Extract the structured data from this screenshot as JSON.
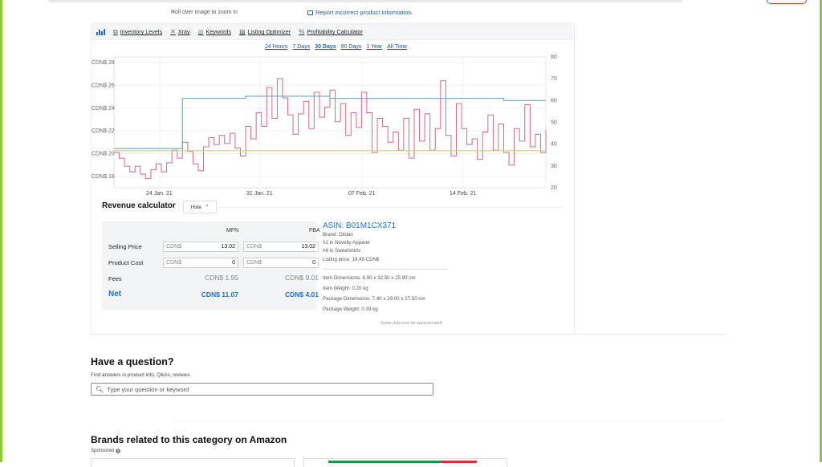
{
  "header": {
    "rollover_text": "Roll over image to zoom in",
    "report_text": "Report incorrect product information."
  },
  "keepa": {
    "toolbar": [
      {
        "icon": "box-icon",
        "label": "Inventory Levels"
      },
      {
        "icon": "close-icon",
        "label": "Xray"
      },
      {
        "icon": "target-icon",
        "label": "Keywords"
      },
      {
        "icon": "document-icon",
        "label": "Listing Optimizer"
      },
      {
        "icon": "percent-icon",
        "label": "Profitability Calculator"
      }
    ],
    "ranges": [
      "24 Hours",
      "7 Days",
      "30 Days",
      "90 Days",
      "1 Year",
      "All Time"
    ],
    "active_range": "30 Days"
  },
  "chart_data": {
    "type": "line",
    "x_ticks": [
      "24 Jan. 21",
      "31 Jan. 21",
      "07 Feb. 21",
      "14 Feb. 21"
    ],
    "y_left_ticks": [
      "CDN$ 18",
      "CDN$ 20",
      "CDN$ 22",
      "CDN$ 24",
      "CDN$ 26",
      "CDN$ 28"
    ],
    "y_right_ticks": [
      "20",
      "30",
      "40",
      "50",
      "60",
      "70",
      "80"
    ],
    "ylim_left": [
      17,
      28.5
    ],
    "ylim_right": [
      20,
      80
    ],
    "grid": true,
    "series": [
      {
        "color": "#d16b82",
        "axis": "left",
        "values": [
          20.1,
          19.6,
          18.9,
          18.4,
          18.9,
          18.2,
          17.8,
          18.6,
          19.1,
          18.4,
          19.2,
          20.3,
          19.6,
          21.0,
          20.2,
          19.1,
          18.5,
          20.6,
          21.4,
          20.8,
          21.6,
          20.9,
          21.8,
          20.5,
          19.8,
          22.4,
          21.3,
          23.6,
          22.4,
          25.8,
          23.1,
          26.6,
          24.9,
          23.4,
          21.7,
          23.5,
          24.6,
          22.2,
          25.4,
          23.2,
          24.1,
          25.6,
          22.8,
          24.4,
          21.6,
          23.6,
          22.3,
          25.4,
          23.6,
          20.1,
          23.1,
          22.4,
          21.0,
          21.9,
          20.3,
          23.1,
          19.6,
          23.9,
          21.1,
          23.5,
          20.3,
          22.2,
          26.4,
          21.6,
          19.8,
          24.4,
          22.2,
          20.8,
          21.3,
          19.5,
          21.9,
          23.4,
          20.3,
          22.6,
          20.1,
          19.0,
          22.2,
          21.1,
          24.3,
          20.6,
          21.7,
          20.1,
          22.1
        ]
      },
      {
        "color": "#6a9fd8",
        "axis": "right",
        "values": [
          38,
          38,
          38,
          38,
          38,
          38,
          38,
          38,
          38,
          38,
          38,
          38,
          38,
          61,
          61,
          61,
          61,
          61,
          61,
          61,
          61,
          61,
          61,
          61,
          61,
          62,
          62,
          62,
          62,
          62,
          62,
          62,
          62,
          62,
          62,
          62,
          62,
          62,
          62,
          62,
          62,
          61,
          61,
          61,
          61,
          61,
          61,
          61,
          61,
          61,
          61,
          61,
          61,
          61,
          61,
          61,
          61,
          61,
          61,
          61,
          61,
          61,
          61,
          61,
          61,
          61,
          61,
          61,
          61,
          61,
          61,
          61,
          61,
          61,
          60,
          60,
          60,
          60,
          60,
          60,
          60,
          60,
          60
        ]
      },
      {
        "color": "#d9d26a",
        "axis": "right",
        "values": [
          37,
          37,
          37,
          37,
          37,
          37,
          37,
          37,
          37,
          37,
          37,
          37,
          37,
          37,
          37,
          37,
          37,
          37,
          37,
          37,
          37,
          37,
          37,
          37,
          37,
          37,
          37,
          37,
          37,
          37,
          37,
          37,
          37,
          37,
          37,
          37,
          37,
          37,
          37,
          37,
          37,
          37,
          37,
          37,
          37,
          37,
          37,
          37,
          37,
          37,
          37,
          37,
          37,
          37,
          37,
          37,
          37,
          37,
          37,
          37,
          37,
          37,
          37,
          37,
          37,
          37,
          37,
          37,
          37,
          37,
          37,
          37,
          37,
          37,
          37,
          37,
          37,
          37,
          37,
          37,
          37,
          37,
          37
        ]
      }
    ]
  },
  "revenue": {
    "title": "Revenue calculator",
    "hide_label": "Hide",
    "col_mfn": "MFN",
    "col_fba": "FBA",
    "currency": "CDN$",
    "selling_price_label": "Selling Price",
    "selling_price_mfn": "13.02",
    "selling_price_fba": "13.02",
    "product_cost_label": "Product Cost",
    "product_cost_mfn": "0",
    "product_cost_fba": "0",
    "fees_label": "Fees",
    "fees_mfn": "CDN$ 1.95",
    "fees_fba": "CDN$ 9.01",
    "net_label": "Net",
    "net_mfn": "CDN$ 11.07",
    "net_fba": "CDN$ 4.01"
  },
  "product": {
    "asin": "ASIN: B01M1CX371",
    "brand": "Brand: Gildan",
    "rank1": "#2 in Novelty Apparel",
    "rank2": "#6 in Sweatshirts",
    "listing_price": "Listing price: 19.49 CDN$",
    "item_dimensions": "Item Dimensions: 8.90 x 32.50 x 25.90 cm",
    "item_weight": "Item Weight: 0.20 kg",
    "package_dimensions": "Package Dimensions: 7.40 x 29.00 x 27.50 cm",
    "package_weight": "Package Weight: 0.39 kg",
    "approx_note": "Some data may be approximated"
  },
  "question": {
    "title": "Have a question?",
    "subtitle": "Find answers in product info, Q&As, reviews",
    "placeholder": "Type your question or keyword"
  },
  "brands": {
    "title": "Brands related to this category on Amazon",
    "sponsored": "Sponsored"
  }
}
